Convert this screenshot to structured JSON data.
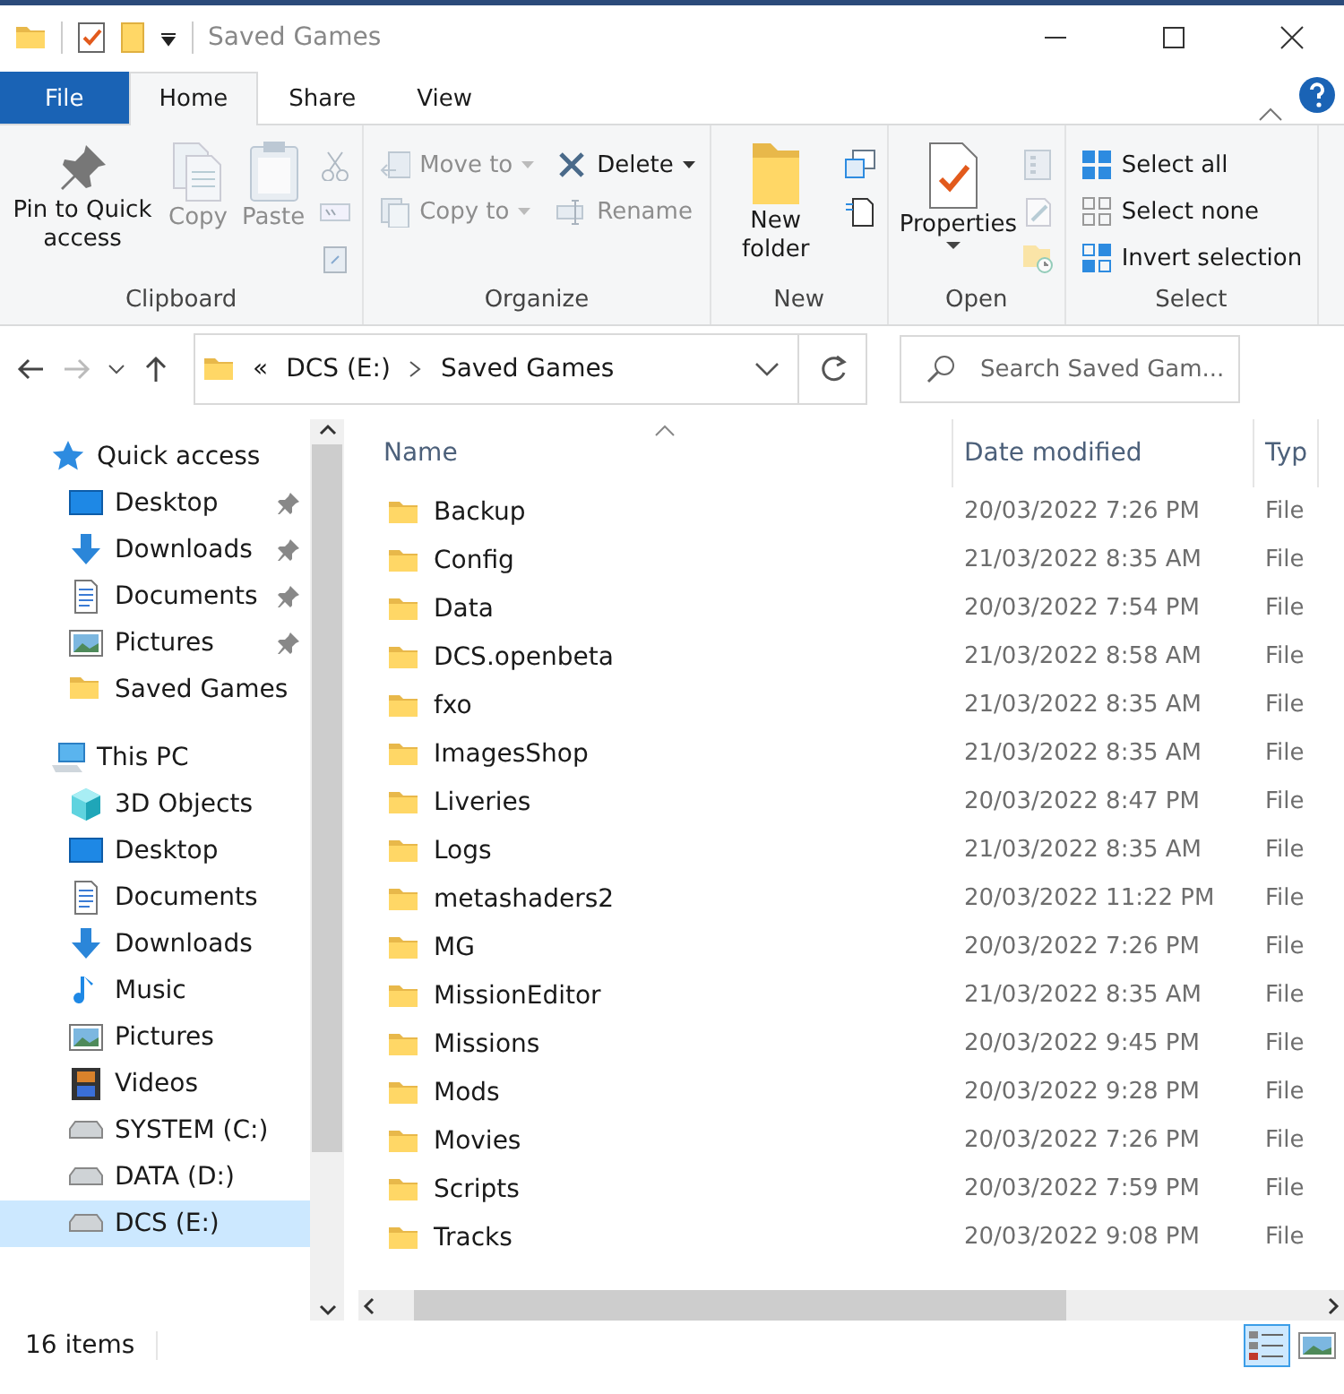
{
  "window": {
    "title": "Saved Games"
  },
  "tabs": [
    {
      "label": "File",
      "kind": "file",
      "selected": false
    },
    {
      "label": "Home",
      "kind": "tab",
      "selected": true
    },
    {
      "label": "Share",
      "kind": "tab",
      "selected": false
    },
    {
      "label": "View",
      "kind": "tab",
      "selected": false
    }
  ],
  "ribbon": [
    {
      "label": "Clipboard",
      "items": [
        {
          "label": "Pin to Quick access",
          "kind": "pin",
          "disabled": false
        },
        {
          "label": "Copy",
          "kind": "copy",
          "disabled": true
        },
        {
          "label": "Paste",
          "kind": "paste",
          "disabled": true
        },
        {
          "kind": "clip-tools",
          "disabled": true
        }
      ]
    },
    {
      "label": "Organize",
      "items": [
        {
          "label": "Move to",
          "kind": "move",
          "disabled": true
        },
        {
          "label": "Copy to",
          "kind": "copyto",
          "disabled": true
        },
        {
          "label": "Delete",
          "kind": "delete",
          "disabled": false
        },
        {
          "label": "Rename",
          "kind": "rename",
          "disabled": true
        }
      ]
    },
    {
      "label": "New",
      "items": [
        {
          "label": "New folder",
          "kind": "newfolder",
          "disabled": false
        },
        {
          "kind": "new-tools",
          "disabled": false
        }
      ]
    },
    {
      "label": "Open",
      "items": [
        {
          "label": "Properties",
          "kind": "properties",
          "disabled": false
        },
        {
          "kind": "open-tools",
          "disabled": true
        }
      ]
    },
    {
      "label": "Select",
      "items": [
        {
          "label": "Select all",
          "kind": "selectall",
          "disabled": false
        },
        {
          "label": "Select none",
          "kind": "selectnone",
          "disabled": false
        },
        {
          "label": "Invert selection",
          "kind": "invert",
          "disabled": false
        }
      ]
    }
  ],
  "address": {
    "path": [
      {
        "label": "«"
      },
      {
        "label": "DCS (E:)"
      },
      {
        "label": "Saved Games"
      }
    ],
    "search_placeholder": "Search Saved Gam..."
  },
  "navigation": [
    {
      "label": "Quick access",
      "kind": "star",
      "selected": false,
      "children": [
        {
          "label": "Desktop",
          "kind": "desktop",
          "pinned": true,
          "selected": false
        },
        {
          "label": "Downloads",
          "kind": "downloads",
          "pinned": true,
          "selected": false
        },
        {
          "label": "Documents",
          "kind": "documents",
          "pinned": true,
          "selected": false
        },
        {
          "label": "Pictures",
          "kind": "pictures",
          "pinned": true,
          "selected": false
        },
        {
          "label": "Saved Games",
          "kind": "folder",
          "pinned": false,
          "selected": false
        }
      ]
    },
    {
      "label": "This PC",
      "kind": "pc",
      "selected": false,
      "children": [
        {
          "label": "3D Objects",
          "kind": "cube",
          "pinned": false,
          "selected": false
        },
        {
          "label": "Desktop",
          "kind": "desktop",
          "pinned": false,
          "selected": false
        },
        {
          "label": "Documents",
          "kind": "documents",
          "pinned": false,
          "selected": false
        },
        {
          "label": "Downloads",
          "kind": "downloads",
          "pinned": false,
          "selected": false
        },
        {
          "label": "Music",
          "kind": "music",
          "pinned": false,
          "selected": false
        },
        {
          "label": "Pictures",
          "kind": "pictures",
          "pinned": false,
          "selected": false
        },
        {
          "label": "Videos",
          "kind": "videos",
          "pinned": false,
          "selected": false
        },
        {
          "label": "SYSTEM (C:)",
          "kind": "drive",
          "pinned": false,
          "selected": false
        },
        {
          "label": "DATA (D:)",
          "kind": "drive",
          "pinned": false,
          "selected": false
        },
        {
          "label": "DCS (E:)",
          "kind": "drive",
          "pinned": false,
          "selected": true
        }
      ]
    }
  ],
  "table": {
    "columns": [
      "Name",
      "Date modified",
      "Typ"
    ],
    "rows": [
      [
        "Backup",
        "20/03/2022 7:26 PM",
        "File"
      ],
      [
        "Config",
        "21/03/2022 8:35 AM",
        "File"
      ],
      [
        "Data",
        "20/03/2022 7:54 PM",
        "File"
      ],
      [
        "DCS.openbeta",
        "21/03/2022 8:58 AM",
        "File"
      ],
      [
        "fxo",
        "21/03/2022 8:35 AM",
        "File"
      ],
      [
        "ImagesShop",
        "21/03/2022 8:35 AM",
        "File"
      ],
      [
        "Liveries",
        "20/03/2022 8:47 PM",
        "File"
      ],
      [
        "Logs",
        "21/03/2022 8:35 AM",
        "File"
      ],
      [
        "metashaders2",
        "20/03/2022 11:22 PM",
        "File"
      ],
      [
        "MG",
        "20/03/2022 7:26 PM",
        "File"
      ],
      [
        "MissionEditor",
        "21/03/2022 8:35 AM",
        "File"
      ],
      [
        "Missions",
        "20/03/2022 9:45 PM",
        "File"
      ],
      [
        "Mods",
        "20/03/2022 9:28 PM",
        "File"
      ],
      [
        "Movies",
        "20/03/2022 7:26 PM",
        "File"
      ],
      [
        "Scripts",
        "20/03/2022 7:59 PM",
        "File"
      ],
      [
        "Tracks",
        "20/03/2022 9:08 PM",
        "File"
      ]
    ]
  },
  "status_bar": {
    "count": "16 items",
    "views": [
      {
        "kind": "details",
        "selected": true
      },
      {
        "kind": "large-icons",
        "selected": false
      }
    ]
  }
}
